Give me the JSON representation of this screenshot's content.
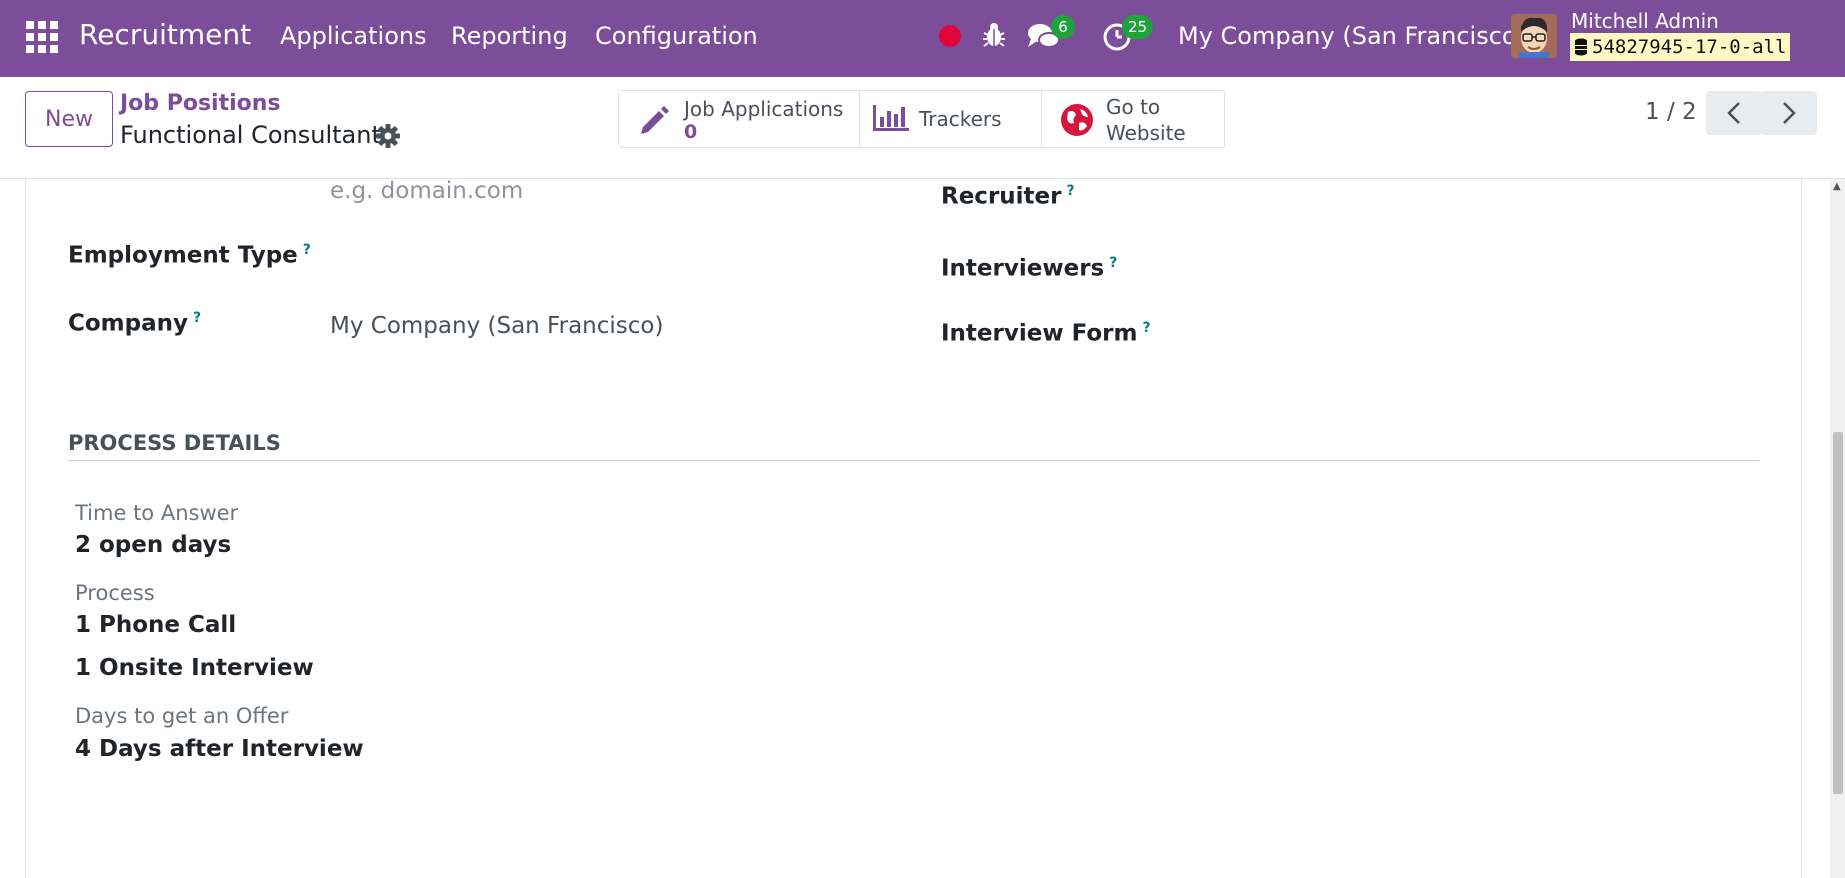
{
  "navbar": {
    "app_name": "Recruitment",
    "menus": [
      "Applications",
      "Reporting",
      "Configuration"
    ],
    "messages_count": "6",
    "activities_count": "25",
    "company": "My Company (San Francisco)",
    "user_name": "Mitchell Admin",
    "database": "54827945-17-0-all",
    "accent_color": "#7c4d99"
  },
  "control": {
    "new_label": "New",
    "breadcrumb_parent": "Job Positions",
    "breadcrumb_current": "Functional Consultant",
    "smart_buttons": {
      "job_applications_label": "Job Applications",
      "job_applications_count": "0",
      "trackers_label": "Trackers",
      "website_label_line1": "Go to",
      "website_label_line2": "Website"
    },
    "pager": "1 / 2"
  },
  "form": {
    "website_placeholder": "e.g. domain.com",
    "employment_type_label": "Employment Type",
    "company_label": "Company",
    "company_value": "My Company (San Francisco)",
    "recruiter_label": "Recruiter",
    "interviewers_label": "Interviewers",
    "interview_form_label": "Interview Form",
    "help_mark": "?"
  },
  "process_details": {
    "title": "PROCESS DETAILS",
    "time_to_answer_label": "Time to Answer",
    "time_to_answer_value": "2 open days",
    "process_label": "Process",
    "process_steps": [
      "1 Phone Call",
      "1 Onsite Interview"
    ],
    "offer_label": "Days to get an Offer",
    "offer_value": "4 Days after Interview"
  }
}
